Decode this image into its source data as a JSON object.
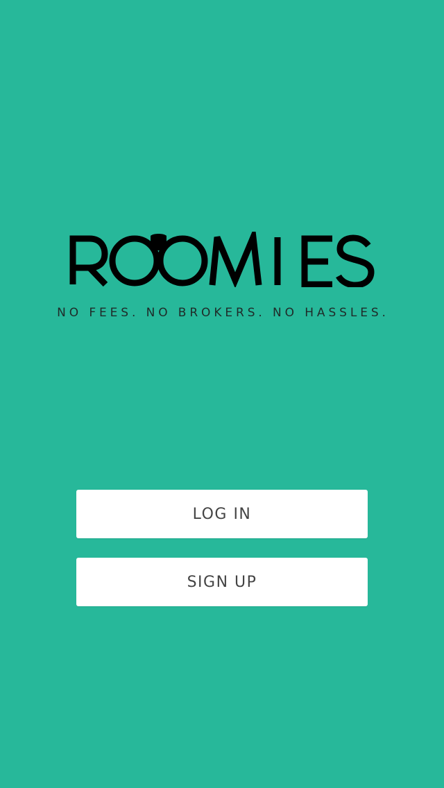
{
  "brand": {
    "logo_text": "ROOMIES",
    "tagline": "NO FEES. NO BROKERS. NO HASSLES.",
    "background_color": "#27b89a",
    "logo_color": "#000000"
  },
  "actions": {
    "login_label": "LOG IN",
    "signup_label": "SIGN UP"
  }
}
